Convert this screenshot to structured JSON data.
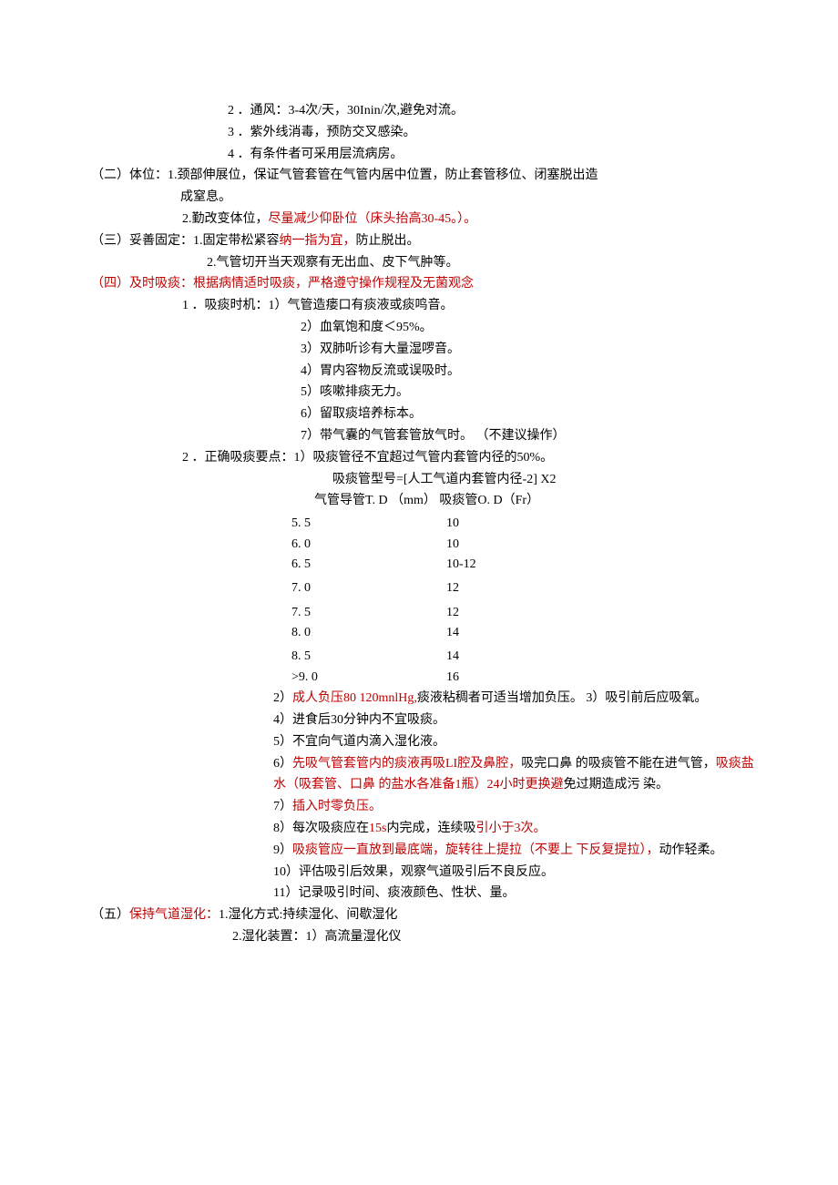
{
  "lines": {
    "l1a": "2 ．通风：3-4次/天，30Inin/次,避免对流。",
    "l1b": "3 ．紫外线消毒，预防交叉感染。",
    "l1c": "4 ．有条件者可采用层流病房。",
    "s2": {
      "prefix": "（二）体位：1.颈部伸展位，保证气管套管在气管内居中位置，防止套管移位、闭塞脱出造",
      "cont": "成窒息。",
      "line2a": "2.勤改变体位，",
      "line2b": "尽量减少仰卧位（床头抬高30-45。）。"
    },
    "s3": {
      "prefix": "（三）妥善固定：1.固定带松紧容",
      "red": "纳一指为宜，",
      "suffix": "防止脱出。",
      "line2": "2.气管切开当天观察有无出血、皮下气肿等。"
    },
    "s4": {
      "header": "（四）及时吸痰：根据病情适时吸痰，严格遵守操作规程及无菌观念",
      "p1_head": "1 ．吸痰时机：1）气管造瘘口有痰液或痰鸣音。",
      "p1_2": "2）血氧饱和度＜95%。",
      "p1_3": "3）双肺听诊有大量湿啰音。",
      "p1_4": "4）胃内容物反流或误吸时。",
      "p1_5": "5）咳嗽排痰无力。",
      "p1_6": "6）留取痰培养标本。",
      "p1_7": "7）带气囊的气管套管放气时。 （不建议操作）",
      "p2_head": "2 ．正确吸痰要点：1）吸痰管径不宜超过气管内套管内径的50%。",
      "p2_formula": "吸痰管型号=[人工气道内套管内径-2] X2",
      "tbl_header": "气管导管T. D （mm） 吸痰管O. D（Fr）",
      "p2_2a": "2）",
      "p2_2b": "成人负压80 120mnlHg,",
      "p2_2c": "痰液粘稠者可适当增加负压。 3）吸引前后应吸氧。",
      "p2_4": "4）进食后30分钟内不宜吸痰。",
      "p2_5": "5）不宜向气道内滴入湿化液。",
      "p2_6a": "6）",
      "p2_6b": "先吸气管套管内的痰液再吸LI腔及鼻腔，",
      "p2_6c": "吸完口鼻 的吸痰管不能在进气管，",
      "p2_6d": "吸痰盐水（吸套管、口鼻 的盐水各准备1瓶）24小时更换避",
      "p2_6e": "免过期造成污 染。",
      "p2_7a": "7）",
      "p2_7b": "插入时零负压。",
      "p2_8a": "8）每次吸痰应在",
      "p2_8b": "15s",
      "p2_8c": "内完成，连续吸",
      "p2_8d": "引小于3次。",
      "p2_9a": "9）",
      "p2_9b": "吸痰管应一直放到最底端，旋转往上提拉（不要上  下反复提拉），",
      "p2_9c": "动作轻柔。",
      "p2_10": "10）评估吸引后效果，观察气道吸引后不良反应。",
      "p2_11": "11）记录吸引时间、痰液颜色、性状、量。"
    },
    "s5": {
      "prefix": "（五）",
      "red": "保持气道湿化：",
      "suffix": "1.湿化方式:持续湿化、间歇湿化",
      "line2": "2.湿化装置：1）高流量湿化仪"
    }
  },
  "chart_data": {
    "type": "table",
    "title": "气管导管T. D （mm） 吸痰管O. D（Fr）",
    "columns": [
      "气管导管T. D (mm)",
      "吸痰管O. D (Fr)"
    ],
    "rows": [
      [
        "5. 5",
        "10"
      ],
      [
        "6. 0",
        "10"
      ],
      [
        "6. 5",
        "10-12"
      ],
      [
        "7. 0",
        "12"
      ],
      [
        "7. 5",
        "12"
      ],
      [
        "8. 0",
        "14"
      ],
      [
        "8. 5",
        "14"
      ],
      [
        ">9. 0",
        "16"
      ]
    ]
  }
}
